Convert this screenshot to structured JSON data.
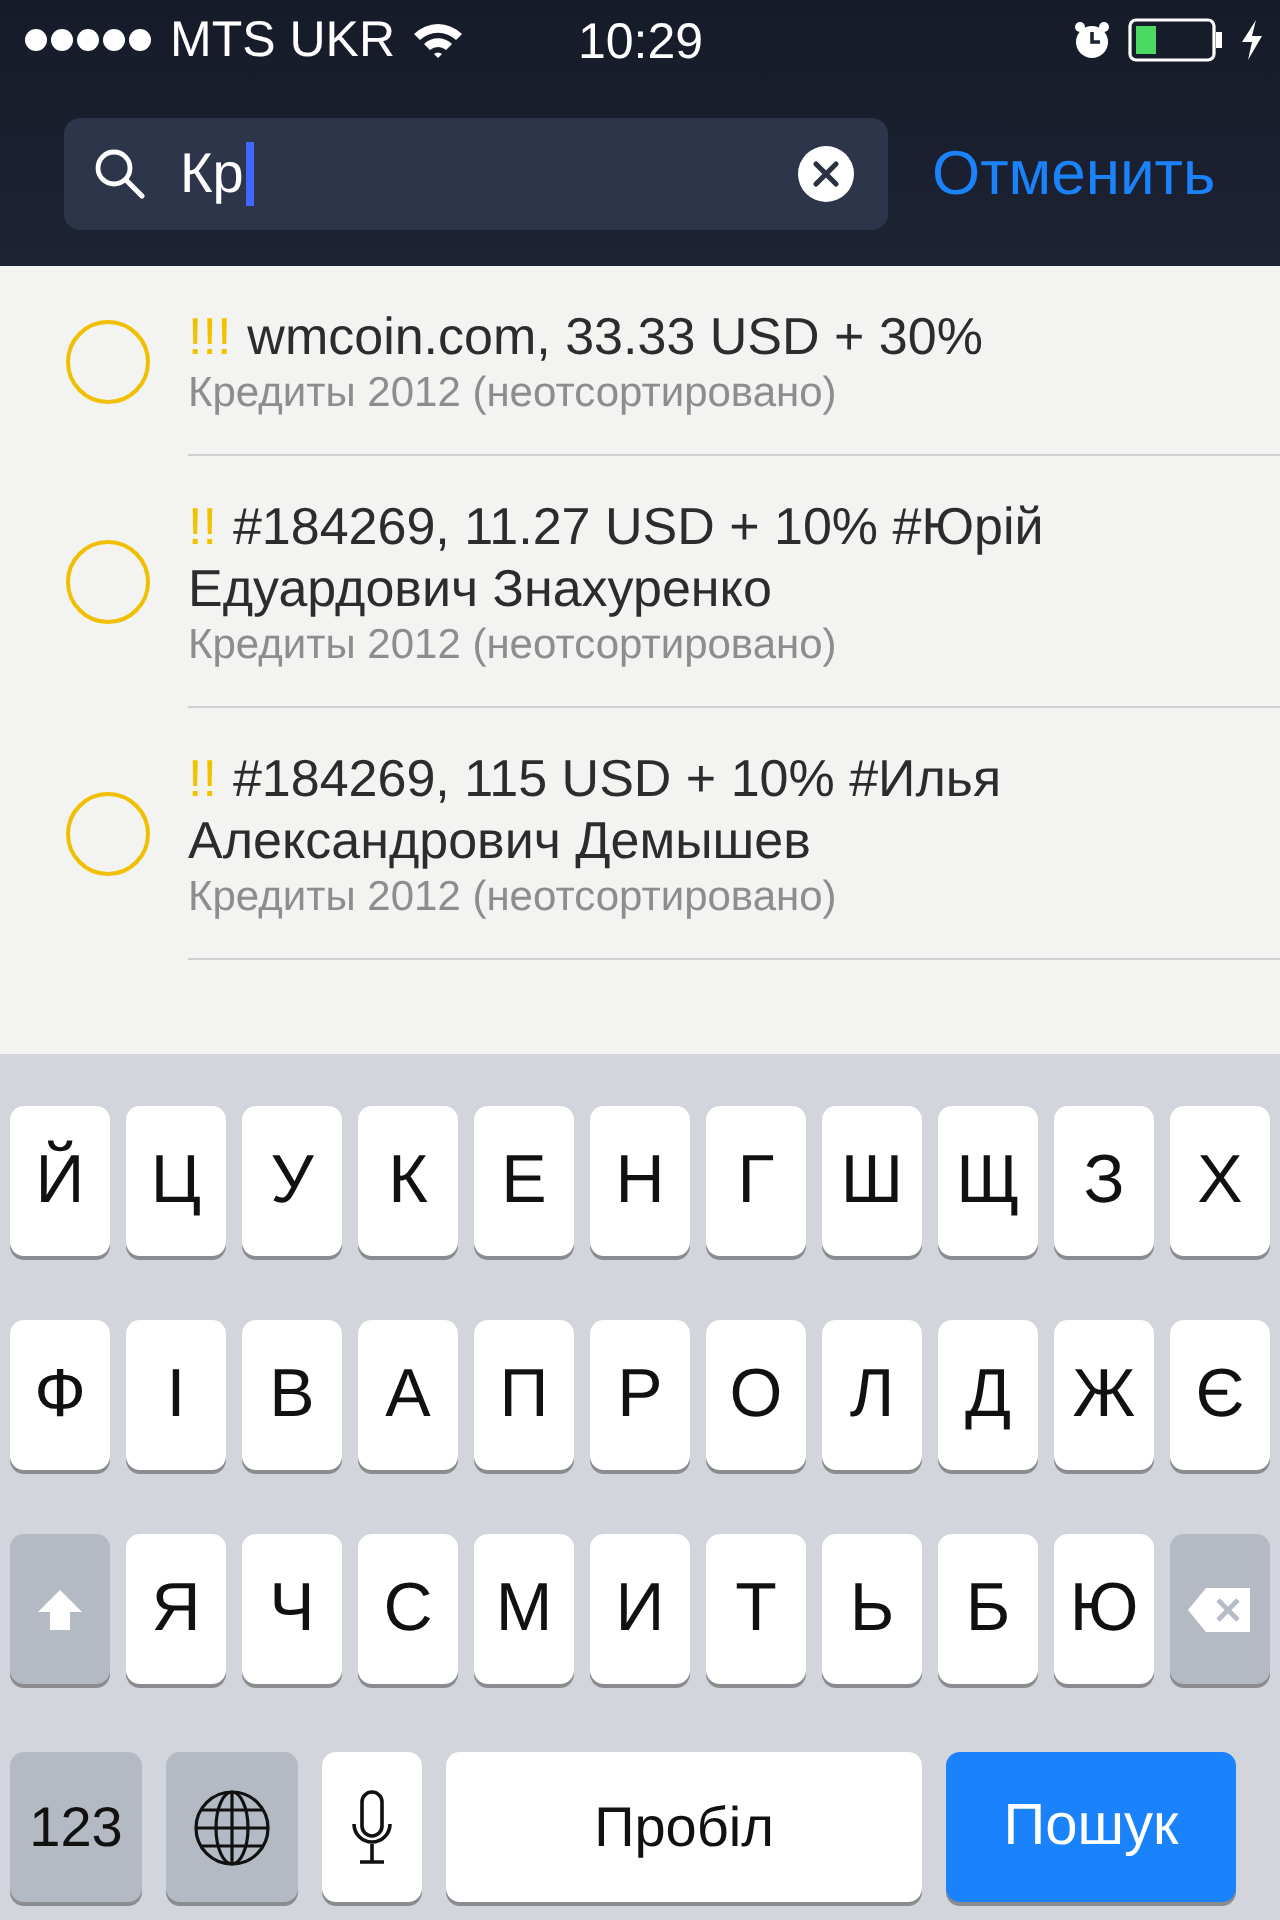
{
  "status_bar": {
    "carrier": "MTS UKR",
    "time": "10:29"
  },
  "search": {
    "value": "Кр",
    "cancel": "Отменить"
  },
  "tasks": [
    {
      "priority": "!!!",
      "title": "wmcoin.com, 33.33 USD + 30%",
      "list": "Кредиты 2012 (неотсортировано)",
      "completed": false
    },
    {
      "priority": "!!",
      "title": "#184269, 11.27 USD + 10% #Юрій Едуардович Знахуренко",
      "list": "Кредиты 2012 (неотсортировано)",
      "completed": false
    },
    {
      "priority": "!!",
      "title": "#184269, 115 USD + 10% #Илья Александрович Демышев",
      "list": "Кредиты 2012 (неотсортировано)",
      "completed": false
    }
  ],
  "keyboard": {
    "rows": [
      [
        {
          "kind": "letter",
          "label": "Й"
        },
        {
          "kind": "letter",
          "label": "Ц"
        },
        {
          "kind": "letter",
          "label": "У"
        },
        {
          "kind": "letter",
          "label": "К"
        },
        {
          "kind": "letter",
          "label": "Е"
        },
        {
          "kind": "letter",
          "label": "Н"
        },
        {
          "kind": "letter",
          "label": "Г"
        },
        {
          "kind": "letter",
          "label": "Ш"
        },
        {
          "kind": "letter",
          "label": "Щ"
        },
        {
          "kind": "letter",
          "label": "З"
        },
        {
          "kind": "letter",
          "label": "Х"
        }
      ],
      [
        {
          "kind": "letter",
          "label": "Ф"
        },
        {
          "kind": "letter",
          "label": "І"
        },
        {
          "kind": "letter",
          "label": "В"
        },
        {
          "kind": "letter",
          "label": "А"
        },
        {
          "kind": "letter",
          "label": "П"
        },
        {
          "kind": "letter",
          "label": "Р"
        },
        {
          "kind": "letter",
          "label": "О"
        },
        {
          "kind": "letter",
          "label": "Л"
        },
        {
          "kind": "letter",
          "label": "Д"
        },
        {
          "kind": "letter",
          "label": "Ж"
        },
        {
          "kind": "letter",
          "label": "Є"
        }
      ],
      [
        {
          "kind": "shift"
        },
        {
          "kind": "letter",
          "label": "Я"
        },
        {
          "kind": "letter",
          "label": "Ч"
        },
        {
          "kind": "letter",
          "label": "С"
        },
        {
          "kind": "letter",
          "label": "М"
        },
        {
          "kind": "letter",
          "label": "И"
        },
        {
          "kind": "letter",
          "label": "Т"
        },
        {
          "kind": "letter",
          "label": "Ь"
        },
        {
          "kind": "letter",
          "label": "Б"
        },
        {
          "kind": "letter",
          "label": "Ю"
        },
        {
          "kind": "delete"
        }
      ]
    ],
    "bottom_row": [
      {
        "kind": "numbers",
        "label": "123"
      },
      {
        "kind": "globe"
      },
      {
        "kind": "mic"
      },
      {
        "kind": "space",
        "label": "Пробіл"
      },
      {
        "kind": "search",
        "label": "Пошук"
      }
    ]
  }
}
